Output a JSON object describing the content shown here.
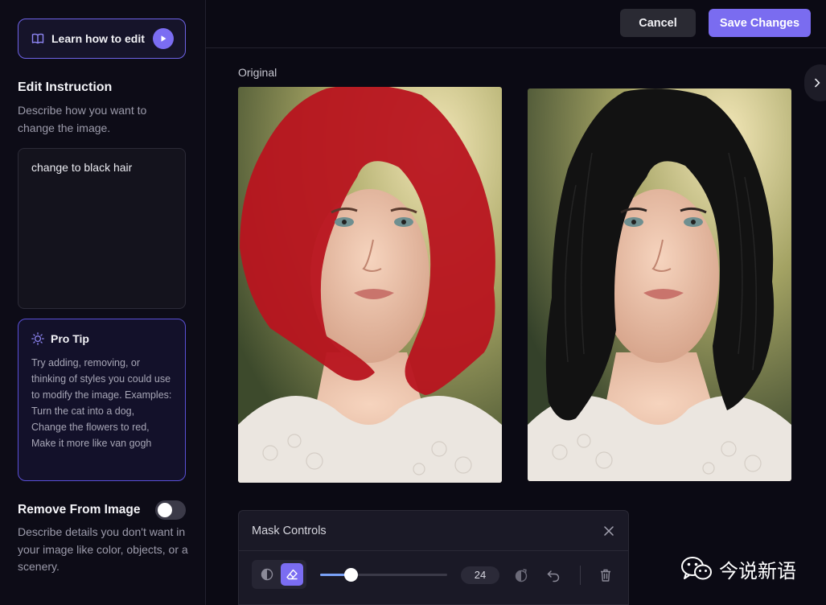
{
  "sidebar": {
    "learn_label": "Learn how to edit",
    "edit_title": "Edit Instruction",
    "edit_desc": "Describe how you want to change the image.",
    "instruction_value": "change to black hair",
    "pro_tip": {
      "title": "Pro Tip",
      "body": "Try adding, removing, or thinking of styles you could use to modify the image. Examples: Turn the cat into a dog, Change the flowers to red, Make it more like van gogh"
    },
    "remove_title": "Remove From Image",
    "remove_toggle_on": false,
    "remove_desc": "Describe details you don't want in your image like color, objects, or a scenery."
  },
  "toolbar": {
    "cancel_label": "Cancel",
    "save_label": "Save Changes"
  },
  "canvas": {
    "original_label": "Original"
  },
  "mask_controls": {
    "title": "Mask Controls",
    "brush_size": "24",
    "brush_slider_fraction": 0.24,
    "active_tool": "eraser"
  },
  "watermark": {
    "text": "今说新语"
  },
  "colors": {
    "accent": "#7a6cf0",
    "mask_red": "#b8141f",
    "background": "#0b0a14"
  }
}
